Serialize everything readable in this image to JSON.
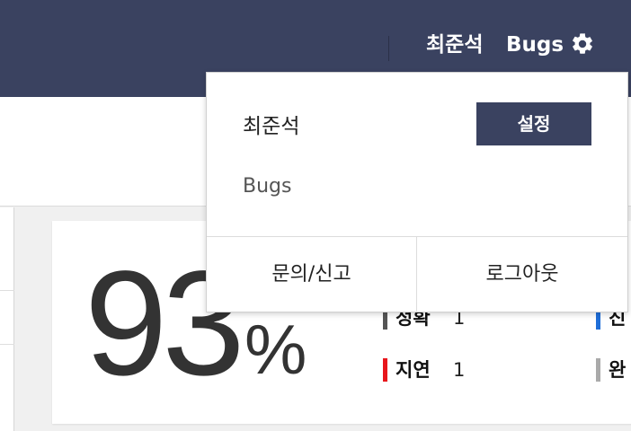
{
  "header": {
    "user_name": "최준석",
    "org_name": "Bugs",
    "settings_icon": "gear-icon"
  },
  "dropdown": {
    "name": "최준석",
    "settings_label": "설정",
    "org": "Bugs",
    "contact_label": "문의/신고",
    "logout_label": "로그아웃"
  },
  "stats": {
    "percent_value": "93",
    "percent_sign": "%",
    "items": [
      {
        "label": "정확",
        "value": "1",
        "color": "#555555"
      },
      {
        "label": "지연",
        "value": "1",
        "color": "#e8161c"
      },
      {
        "label": "진",
        "value": "",
        "color": "#1f6ed8"
      },
      {
        "label": "완",
        "value": "",
        "color": "#aaaaaa"
      }
    ]
  },
  "colors": {
    "header_bg": "#3a4260",
    "delay_red": "#e8161c",
    "progress_blue": "#1f6ed8"
  }
}
